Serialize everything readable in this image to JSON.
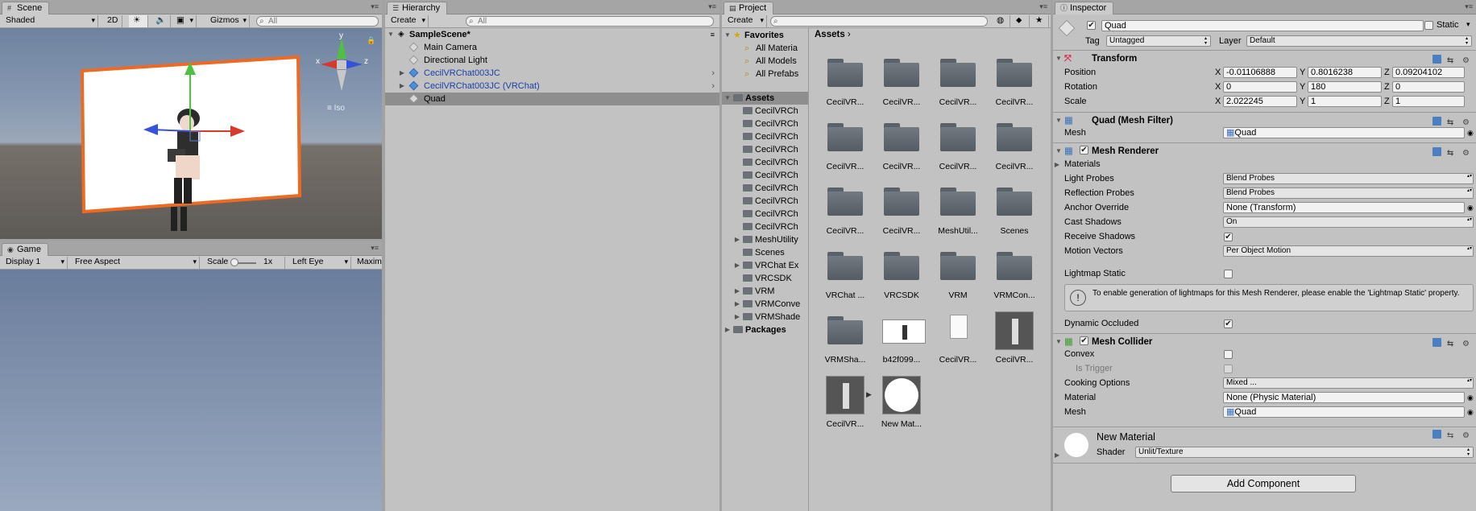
{
  "scene": {
    "tab": "Scene",
    "shading": "Shaded",
    "mode_2d": "2D",
    "gizmos": "Gizmos",
    "search_placeholder": "All",
    "gizmo_x": "x",
    "gizmo_y": "y",
    "gizmo_z": "z",
    "persp_label": "≡ Iso"
  },
  "game": {
    "tab": "Game",
    "display": "Display 1",
    "aspect": "Free Aspect",
    "scale_label": "Scale",
    "scale_value": "1x",
    "eye": "Left Eye",
    "maximize": "Maxim"
  },
  "hierarchy": {
    "tab": "Hierarchy",
    "create": "Create",
    "search_placeholder": "All",
    "scene_name": "SampleScene*",
    "items": [
      {
        "label": "Main Camera"
      },
      {
        "label": "Directional Light"
      },
      {
        "label": "CecilVRChat003JC"
      },
      {
        "label": "CecilVRChat003JC (VRChat)"
      },
      {
        "label": "Quad"
      }
    ]
  },
  "project": {
    "tab": "Project",
    "create": "Create",
    "favorites": "Favorites",
    "fav_items": [
      "All Materia",
      "All Models",
      "All Prefabs"
    ],
    "assets_label": "Assets",
    "tree": [
      "CecilVRCh",
      "CecilVRCh",
      "CecilVRCh",
      "CecilVRCh",
      "CecilVRCh",
      "CecilVRCh",
      "CecilVRCh",
      "CecilVRCh",
      "CecilVRCh",
      "CecilVRCh",
      "MeshUtility",
      "Scenes",
      "VRChat Ex",
      "VRCSDK",
      "VRM",
      "VRMConve",
      "VRMShade"
    ],
    "packages": "Packages",
    "breadcrumb": "Assets",
    "grid": [
      "CecilVR...",
      "CecilVR...",
      "CecilVR...",
      "CecilVR...",
      "CecilVR...",
      "CecilVR...",
      "CecilVR...",
      "CecilVR...",
      "CecilVR...",
      "CecilVR...",
      "MeshUtil...",
      "Scenes",
      "VRChat ...",
      "VRCSDK",
      "VRM",
      "VRMCon...",
      "VRMSha...",
      "b42f099...",
      "CecilVR...",
      "CecilVR...",
      "CecilVR...",
      "New Mat..."
    ]
  },
  "inspector": {
    "tab": "Inspector",
    "object_name": "Quad",
    "static_label": "Static",
    "tag_label": "Tag",
    "tag_value": "Untagged",
    "layer_label": "Layer",
    "layer_value": "Default",
    "transform": {
      "title": "Transform",
      "position_label": "Position",
      "rotation_label": "Rotation",
      "scale_label": "Scale",
      "position": [
        "-0.01106888",
        "0.8016238",
        "0.09204102"
      ],
      "rotation": [
        "0",
        "180",
        "0"
      ],
      "scale": [
        "2.022245",
        "1",
        "1"
      ]
    },
    "mesh_filter": {
      "title": "Quad (Mesh Filter)",
      "mesh_label": "Mesh",
      "mesh_value": "Quad"
    },
    "mesh_renderer": {
      "title": "Mesh Renderer",
      "materials": "Materials",
      "light_probes_label": "Light Probes",
      "light_probes": "Blend Probes",
      "reflection_probes_label": "Reflection Probes",
      "reflection_probes": "Blend Probes",
      "anchor_label": "Anchor Override",
      "anchor": "None (Transform)",
      "cast_label": "Cast Shadows",
      "cast": "On",
      "receive_label": "Receive Shadows",
      "motion_label": "Motion Vectors",
      "motion": "Per Object Motion",
      "lightmap_label": "Lightmap Static",
      "info": "To enable generation of lightmaps for this Mesh Renderer, please enable the 'Lightmap Static' property.",
      "occluded_label": "Dynamic Occluded"
    },
    "mesh_collider": {
      "title": "Mesh Collider",
      "convex_label": "Convex",
      "trigger_label": "Is Trigger",
      "cooking_label": "Cooking Options",
      "cooking": "Mixed ...",
      "material_label": "Material",
      "material": "None (Physic Material)",
      "mesh_label": "Mesh",
      "mesh": "Quad"
    },
    "material": {
      "title": "New Material",
      "shader_label": "Shader",
      "shader": "Unlit/Texture"
    },
    "add_component": "Add Component"
  }
}
